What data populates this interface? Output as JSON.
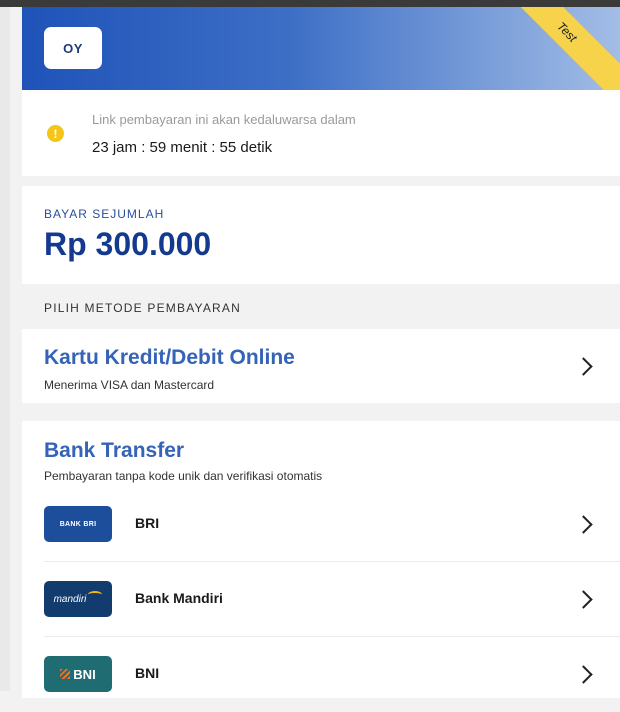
{
  "header": {
    "logo_text": "OY",
    "ribbon_label": "Test",
    "colors": {
      "gradient_start": "#1f53b8",
      "gradient_end": "#a3bde6",
      "ribbon": "#f6d34a"
    }
  },
  "expiry": {
    "icon": "warning-icon",
    "icon_glyph": "!",
    "label": "Link pembayaran ini akan kedaluwarsa dalam",
    "countdown": "23 jam : 59 menit : 55 detik"
  },
  "amount": {
    "label": "BAYAR SEJUMLAH",
    "value": "Rp 300.000"
  },
  "payment_method": {
    "title": "PILIH METODE PEMBAYARAN",
    "card": {
      "title": "Kartu Kredit/Debit Online",
      "subtitle": "Menerima VISA dan Mastercard"
    },
    "bank_transfer": {
      "title": "Bank Transfer",
      "subtitle": "Pembayaran tanpa kode unik dan verifikasi otomatis",
      "banks": [
        {
          "name": "BRI",
          "logo_text": "BANK BRI",
          "logo_color": "#1c4e9c"
        },
        {
          "name": "Bank Mandiri",
          "logo_text": "mandiri",
          "logo_color": "#123b6e"
        },
        {
          "name": "BNI",
          "logo_text": "BNI",
          "logo_color": "#1f6d73"
        }
      ]
    }
  }
}
